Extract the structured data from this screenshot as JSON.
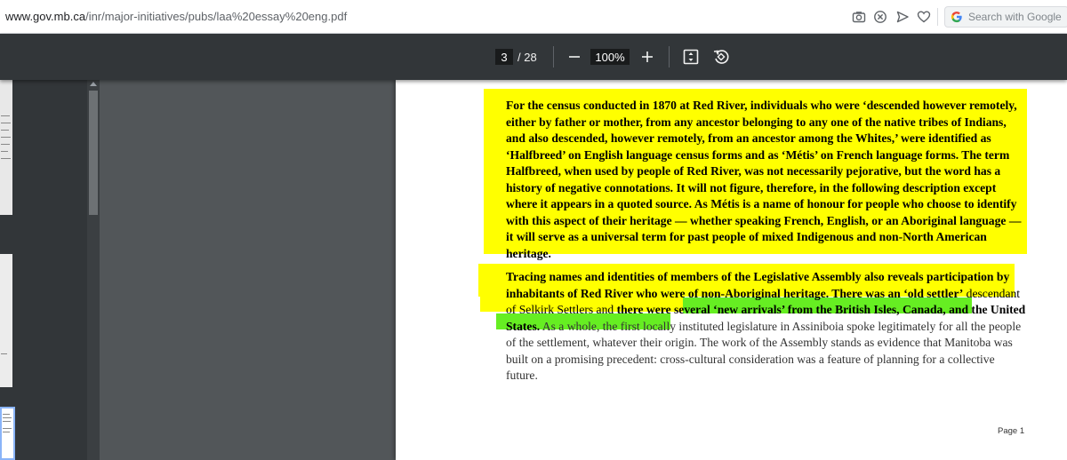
{
  "browser": {
    "url_host": "www.gov.mb.ca",
    "url_path": "/inr/major-initiatives/pubs/laa%20essay%20eng.pdf",
    "icons": [
      "camera-icon",
      "blocked-icon",
      "send-icon",
      "heart-icon",
      "google-icon"
    ],
    "search_placeholder": "Search with Google"
  },
  "pdf_toolbar": {
    "current_page": "3",
    "total_pages": "/ 28",
    "zoom": "100%",
    "icons": [
      "zoom-out-icon",
      "zoom-in-icon",
      "fit-page-icon",
      "rotate-icon"
    ]
  },
  "document": {
    "paragraph1": "For the census conducted in 1870 at Red River, individuals who were ‘descended however remotely, either by father or mother, from any ancestor belonging to any one of the native tribes of Indians, and also descended, however remotely, from an ancestor among the Whites,’ were identified as ‘Halfbreed’ on English language census forms and as ‘Métis’ on French language forms. The term Halfbreed, when used by people of Red River, was not necessarily pejorative, but the word has a history of negative connotations. It will not figure, therefore, in the following description except where it appears in a quoted source. As Métis is a name of honour for people who choose to identify with this aspect of their heritage — whether speaking French, English, or an Aboriginal language — it will serve as a universal term for past people of mixed Indigenous and non-North American heritage.",
    "paragraph2_part1": "Tracing names and identities of members of the Legislative Assembly also reveals participation by inhabitants of Red River who were of non-Aboriginal heritage. There was an ‘old settler’",
    "paragraph2_part2": " descendant of Selkirk Settlers and ",
    "paragraph2_part3": "there were several ‘new arrivals’ from the British Isles, Canada, and the United States.",
    "paragraph2_part4": " As a whole, the first locally instituted legislature in Assiniboia spoke legitimately for all the people of the settlement, whatever their origin. The work of the Assembly stands as evidence that Manitoba was built on a promising precedent: cross-cultural consideration was a feature of planning for a collective future.",
    "page_label": "Page 1"
  },
  "colors": {
    "highlight_yellow": "#ffff00",
    "highlight_green": "#66ee22",
    "toolbar": "#323639",
    "viewer_bg": "#525659"
  }
}
